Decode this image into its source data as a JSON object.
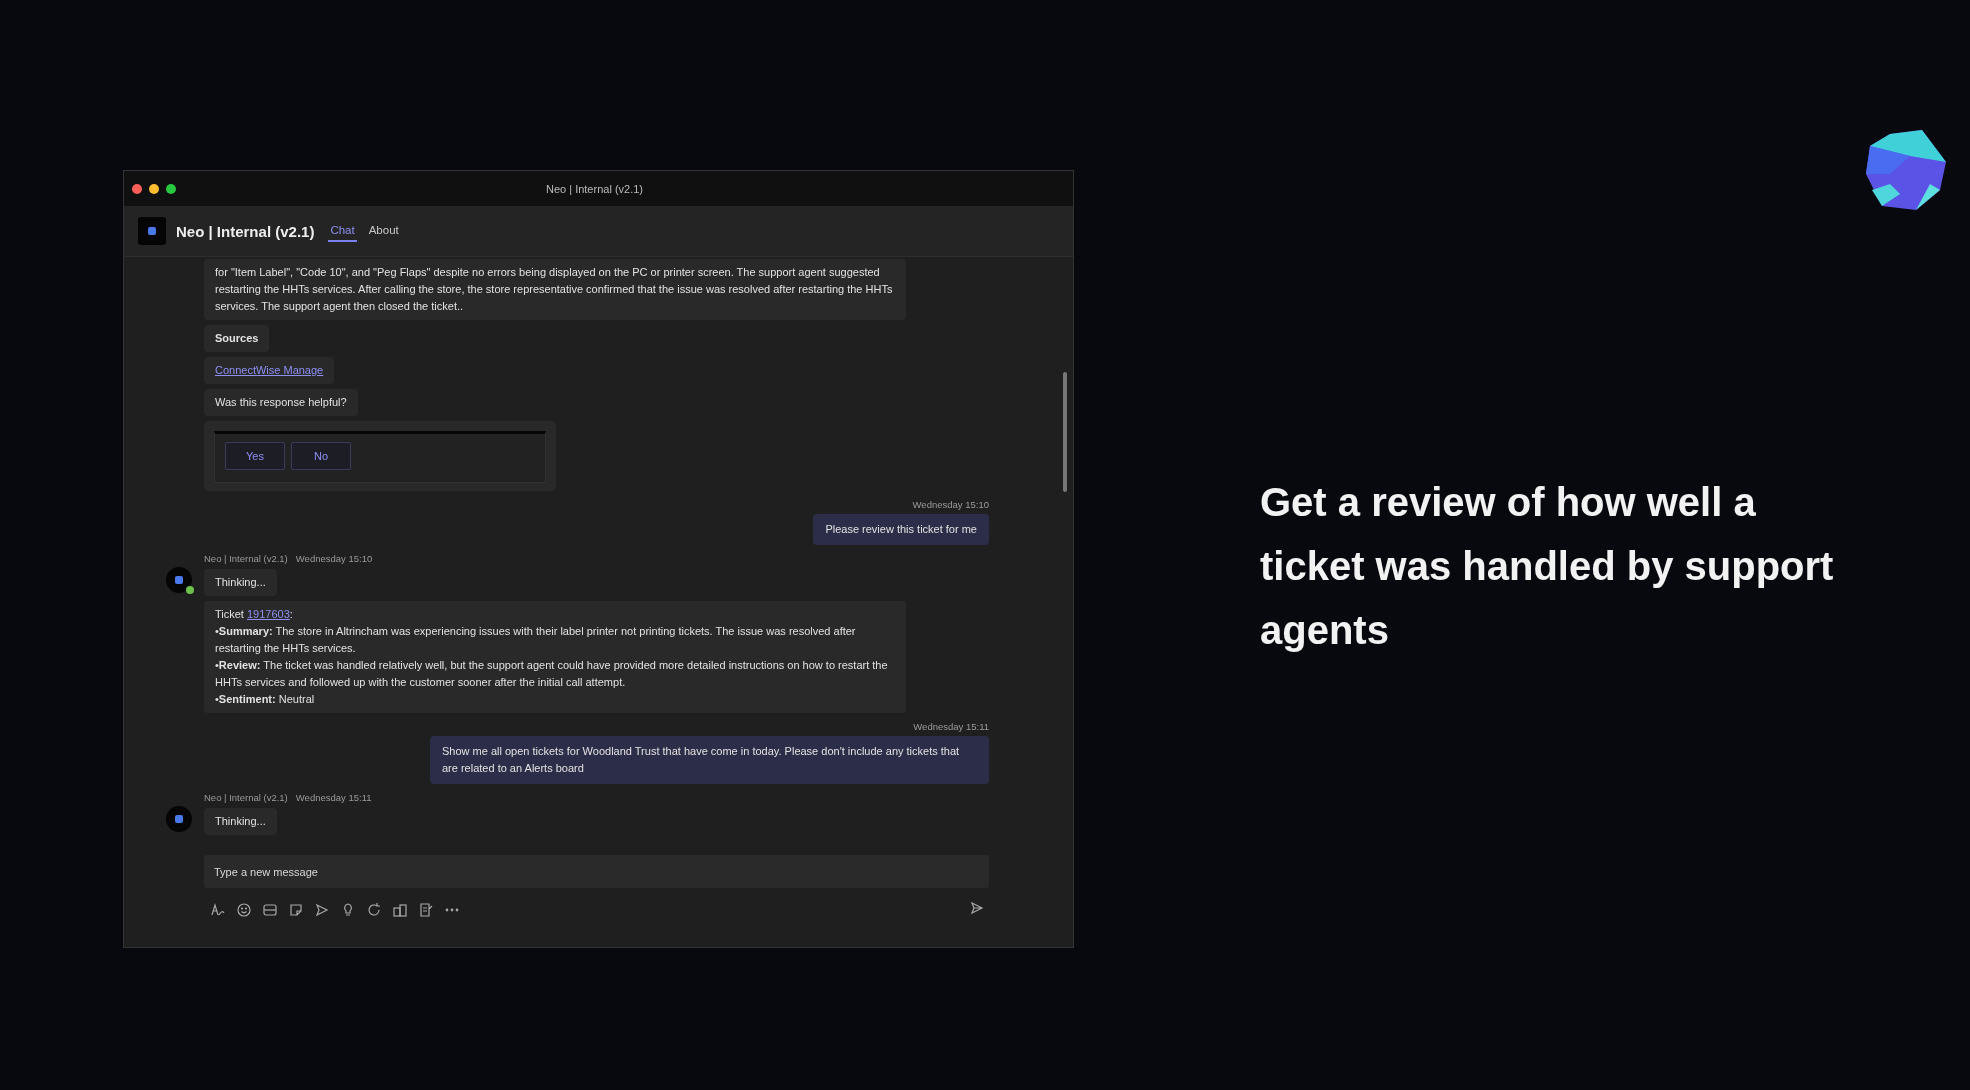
{
  "window": {
    "title": "Neo | Internal (v2.1)"
  },
  "app_header": {
    "name": "Neo | Internal (v2.1)",
    "tabs": [
      {
        "label": "Chat",
        "selected": true
      },
      {
        "label": "About",
        "selected": false
      }
    ]
  },
  "messages": [
    {
      "kind": "bot",
      "bubbles": [
        {
          "kind": "text",
          "text": "for \"Item Label\", \"Code 10\", and \"Peg Flaps\" despite no errors being displayed on the PC or printer screen. The support agent suggested restarting the HHTs services. After calling the store, the store representative confirmed that the issue was resolved after restarting the HHTs services. The support agent then closed the ticket.."
        },
        {
          "kind": "heading",
          "text": "Sources"
        },
        {
          "kind": "link",
          "text": "ConnectWise Manage"
        },
        {
          "kind": "text",
          "text": "Was this response helpful?"
        },
        {
          "kind": "feedback",
          "buttons": [
            "Yes",
            "No"
          ]
        }
      ]
    },
    {
      "kind": "user",
      "time": "Wednesday 15:10",
      "text": "Please review this ticket for me"
    },
    {
      "kind": "bot",
      "sender": "Neo | Internal (v2.1)",
      "time": "Wednesday 15:10",
      "online": true,
      "bubbles": [
        {
          "kind": "text",
          "text": "Thinking..."
        },
        {
          "kind": "ticket",
          "prefix": "Ticket",
          "link": "1917603",
          "suffix": ":",
          "lines": [
            "•**Summary:** The store in Altrincham was experiencing issues with their label printer not printing tickets. The issue was resolved after restarting the HHTs services.",
            "•**Review:** The ticket was handled relatively well, but the support agent could have provided more detailed instructions on how to restart the HHTs services and followed up with the customer sooner after the initial call attempt.",
            "•**Sentiment:** Neutral"
          ]
        }
      ]
    },
    {
      "kind": "user",
      "time": "Wednesday 15:11",
      "text": "Show me all open tickets for Woodland Trust that have come in today. Please don't include any tickets that are related to an Alerts board"
    },
    {
      "kind": "bot",
      "sender": "Neo | Internal (v2.1)",
      "time": "Wednesday 15:11",
      "online": false,
      "bubbles": [
        {
          "kind": "text",
          "text": "Thinking..."
        }
      ]
    }
  ],
  "composer": {
    "placeholder": "Type a new message"
  },
  "caption": "Get a review of how well a ticket was handled by support agents"
}
